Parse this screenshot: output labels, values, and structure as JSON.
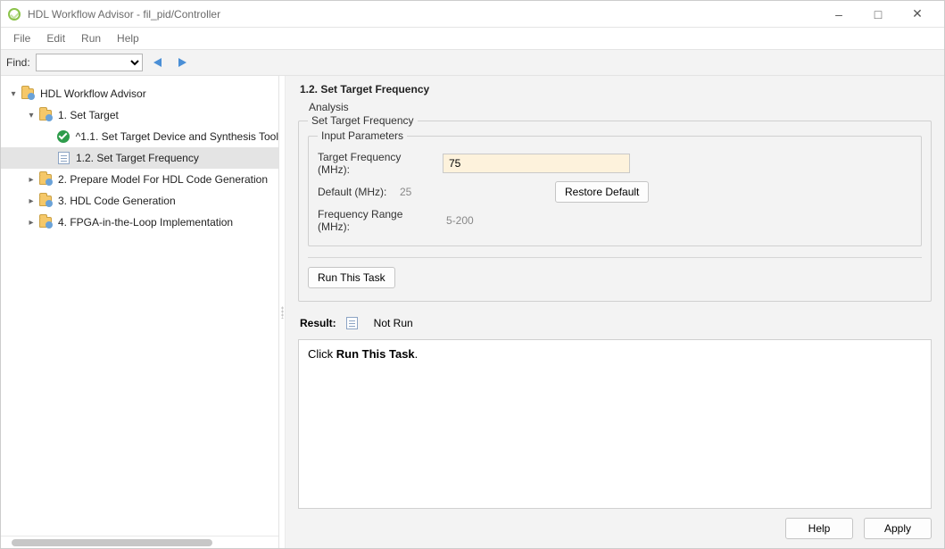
{
  "window": {
    "title": "HDL Workflow Advisor - fil_pid/Controller"
  },
  "menu": {
    "file": "File",
    "edit": "Edit",
    "run": "Run",
    "help": "Help"
  },
  "findbar": {
    "label": "Find:"
  },
  "tree": {
    "root": "HDL Workflow Advisor",
    "n1": "1. Set Target",
    "n1_1": "^1.1. Set Target Device and Synthesis Tool",
    "n1_2": "1.2. Set Target Frequency",
    "n2": "2. Prepare Model For HDL Code Generation",
    "n3": "3. HDL Code Generation",
    "n4": "4. FPGA-in-the-Loop Implementation"
  },
  "panel": {
    "title": "1.2. Set Target Frequency",
    "analysis": "Analysis",
    "group_label": "Set Target Frequency",
    "inner_label": "Input Parameters",
    "rows": {
      "target_label": "Target Frequency (MHz):",
      "target_value": "75",
      "default_label": "Default (MHz):",
      "default_value": "25",
      "restore_btn": "Restore Default",
      "range_label": "Frequency Range (MHz):",
      "range_value": "5-200"
    },
    "run_btn": "Run This Task",
    "result_label": "Result:",
    "result_status": "Not Run",
    "result_text_pre": "Click ",
    "result_text_bold": "Run This Task",
    "result_text_post": "."
  },
  "footer": {
    "help": "Help",
    "apply": "Apply"
  }
}
